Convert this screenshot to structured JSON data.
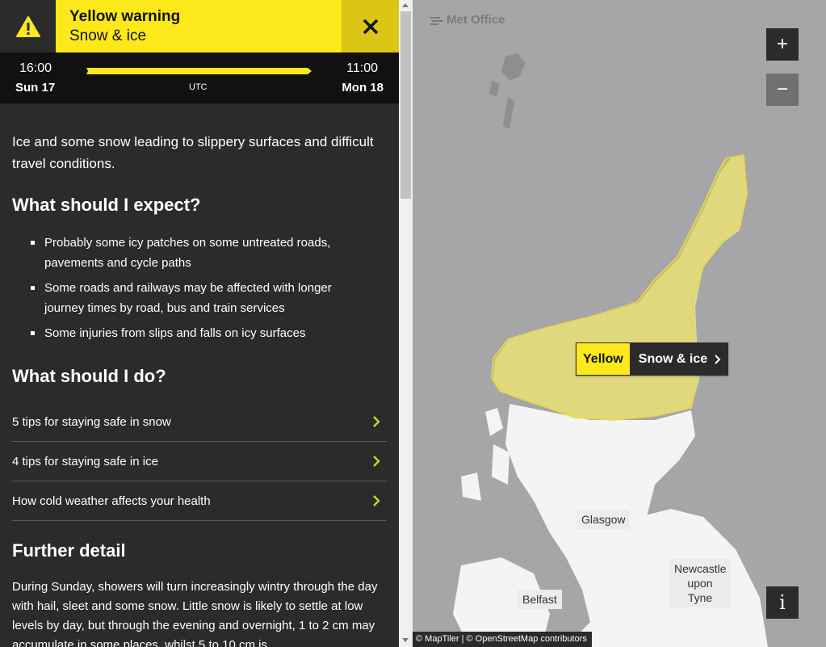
{
  "warning": {
    "title": "Yellow warning",
    "subtitle": "Snow & ice",
    "level_color": "#fde81c",
    "icon": "warning-triangle-icon",
    "close_icon": "close-icon"
  },
  "timeline": {
    "start_time": "16:00",
    "start_day": "Sun 17",
    "end_time": "11:00",
    "end_day": "Mon 18",
    "timezone": "UTC"
  },
  "summary": "Ice and some snow leading to slippery surfaces and difficult travel conditions.",
  "expect": {
    "heading": "What should I expect?",
    "items": [
      "Probably some icy patches on some untreated roads, pavements and cycle paths",
      "Some roads and railways may be affected with longer journey times by road, bus and train services",
      "Some injuries from slips and falls on icy surfaces"
    ]
  },
  "actions": {
    "heading": "What should I do?",
    "links": [
      "5 tips for staying safe in snow",
      "4 tips for staying safe in ice",
      "How cold weather affects your health"
    ]
  },
  "further": {
    "heading": "Further detail",
    "text": "During Sunday, showers will turn increasingly wintry through the day with hail, sleet and some snow. Little snow is likely to settle at low levels by day, but through the evening and overnight, 1 to 2 cm may accumulate in some places, whilst 5 to 10 cm is"
  },
  "map": {
    "brand": "Met Office",
    "zoom_in": "+",
    "zoom_out": "−",
    "info": "i",
    "warning_label": {
      "level": "Yellow",
      "type": "Snow & ice"
    },
    "cities": {
      "glasgow": "Glasgow",
      "newcastle": "Newcastle upon Tyne",
      "belfast": "Belfast"
    },
    "attribution": "© MapTiler | © OpenStreetMap contributors"
  }
}
